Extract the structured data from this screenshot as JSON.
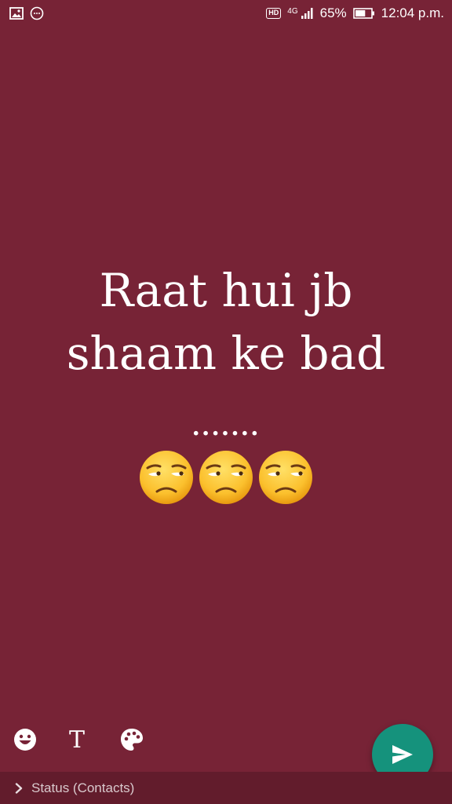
{
  "status_bar": {
    "left_icons": [
      "image-icon",
      "message-icon"
    ],
    "hd": "HD",
    "network": "4G",
    "battery_percent": "65%",
    "battery_level": 0.65,
    "time": "12:04 p.m."
  },
  "story": {
    "line1": "Raat hui jb",
    "line2": "shaam ke bad",
    "dots": ".......",
    "emoji_count": 3,
    "emoji_name": "unamused-face"
  },
  "toolbar": {
    "emoji_icon": "smiley-icon",
    "text_tool": "T",
    "palette_icon": "palette-icon",
    "send_icon": "send-icon"
  },
  "footer": {
    "label": "Status (Contacts)"
  },
  "colors": {
    "background": "#772336",
    "fab": "#15927c",
    "footer": "#621c2c"
  }
}
